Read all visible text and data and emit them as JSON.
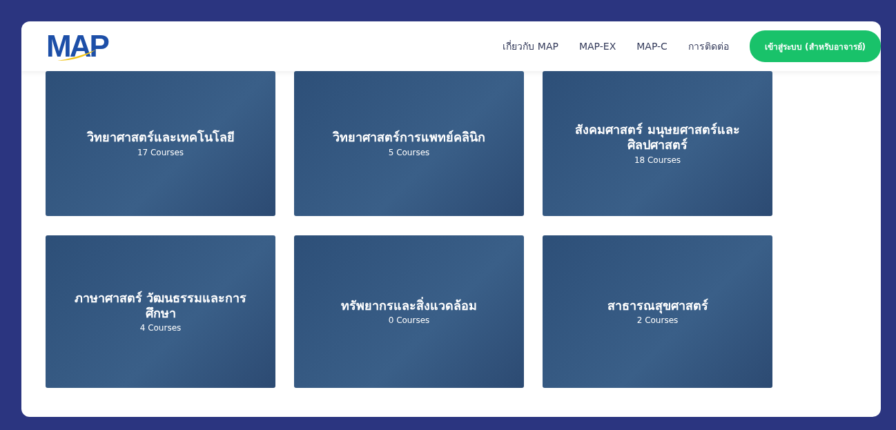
{
  "header": {
    "logo": "MAP",
    "nav": [
      {
        "label": "เกี่ยวกับ MAP"
      },
      {
        "label": "MAP-EX"
      },
      {
        "label": "MAP-C"
      },
      {
        "label": "การติดต่อ"
      }
    ],
    "login_button": "เข้าสู่ระบบ (สำหรับอาจารย์)"
  },
  "categories": [
    {
      "title": "วิทยาศาสตร์และเทคโนโลยี",
      "count": "17 Courses"
    },
    {
      "title": "วิทยาศาสตร์การแพทย์คลินิก",
      "count": "5 Courses"
    },
    {
      "title": "สังคมศาสตร์ มนุษยศาสตร์และศิลปศาสตร์",
      "count": "18 Courses"
    },
    {
      "title": "ภาษาศาสตร์ วัฒนธรรมและการศึกษา",
      "count": "4 Courses"
    },
    {
      "title": "ทรัพยากรและสิ่งแวดล้อม",
      "count": "0 Courses"
    },
    {
      "title": "สาธารณสุขศาสตร์",
      "count": "2 Courses"
    }
  ]
}
